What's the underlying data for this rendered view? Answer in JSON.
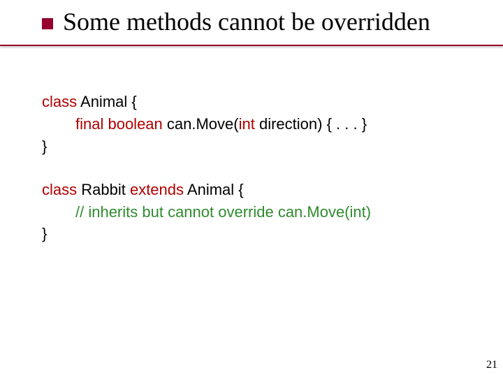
{
  "title": "Some methods cannot be overridden",
  "code1": {
    "line1_a": "class",
    "line1_b": " Animal {",
    "line2_a": "final boolean",
    "line2_b": " can.Move(",
    "line2_c": "int",
    "line2_d": " direction) { . . . }",
    "line3": "}"
  },
  "code2": {
    "line1_a": "class",
    "line1_b": " Rabbit ",
    "line1_c": "extends",
    "line1_d": " Animal {",
    "line2": "// inherits but cannot override can.Move(int)",
    "line3": "}"
  },
  "pageNumber": "21"
}
